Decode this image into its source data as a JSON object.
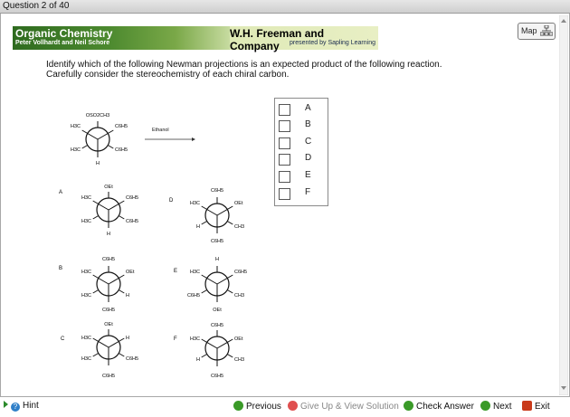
{
  "header": {
    "question_counter": "Question 2 of 40"
  },
  "banner": {
    "title": "Organic Chemistry",
    "authors": "Peter Vollhardt and Neil Schore",
    "publisher": "W.H. Freeman and Company",
    "presented_by": "presented by Sapling Learning"
  },
  "map": {
    "label": "Map"
  },
  "question": {
    "line1": "Identify which of the following Newman projections is an expected product of the following reaction.",
    "line2": "Carefully consider the stereochemistry of each chiral carbon."
  },
  "reaction": {
    "condition": "Ethanol"
  },
  "choices": [
    "A",
    "B",
    "C",
    "D",
    "E",
    "F"
  ],
  "footer": {
    "hint": "Hint",
    "previous": "Previous",
    "give_up": "Give Up & View Solution",
    "check_answer": "Check Answer",
    "next": "Next",
    "exit": "Exit"
  },
  "colors": {
    "banner_green": "#4d8a2f",
    "check": "#3a9a28",
    "exit": "#c93a1a"
  },
  "newman": {
    "reactant": {
      "top": "OSO2CH3",
      "ul": "H3C",
      "ur": "C6H5",
      "l": "H3C",
      "r": "C6H5",
      "b": "H"
    },
    "A": {
      "label": "A",
      "top": "OEt",
      "ul": "H3C",
      "ur": "C6H5",
      "l": "H3C",
      "r": "C6H5",
      "b": "H"
    },
    "B": {
      "label": "B",
      "top": "C6H5",
      "ul": "H3C",
      "ur": "OEt",
      "l": "H3C",
      "r": "H",
      "b": "C6H5"
    },
    "C": {
      "label": "C",
      "top": "OEt",
      "ul": "H3C",
      "ur": "H",
      "l": "H3C",
      "r": "C6H5",
      "b": "C6H5"
    },
    "D": {
      "label": "D",
      "top": "C6H5",
      "ul": "H3C",
      "ur": "OEt",
      "l": "H",
      "r": "CH3",
      "b": "C6H5"
    },
    "E": {
      "label": "E",
      "top": "H",
      "ul": "H3C",
      "ur": "C6H5",
      "l": "C6H5",
      "r": "CH3",
      "b": "OEt"
    },
    "F": {
      "label": "F",
      "top": "C6H5",
      "ul": "H3C",
      "ur": "OEt",
      "l": "H",
      "r": "CH3",
      "b": "C6H5"
    }
  }
}
